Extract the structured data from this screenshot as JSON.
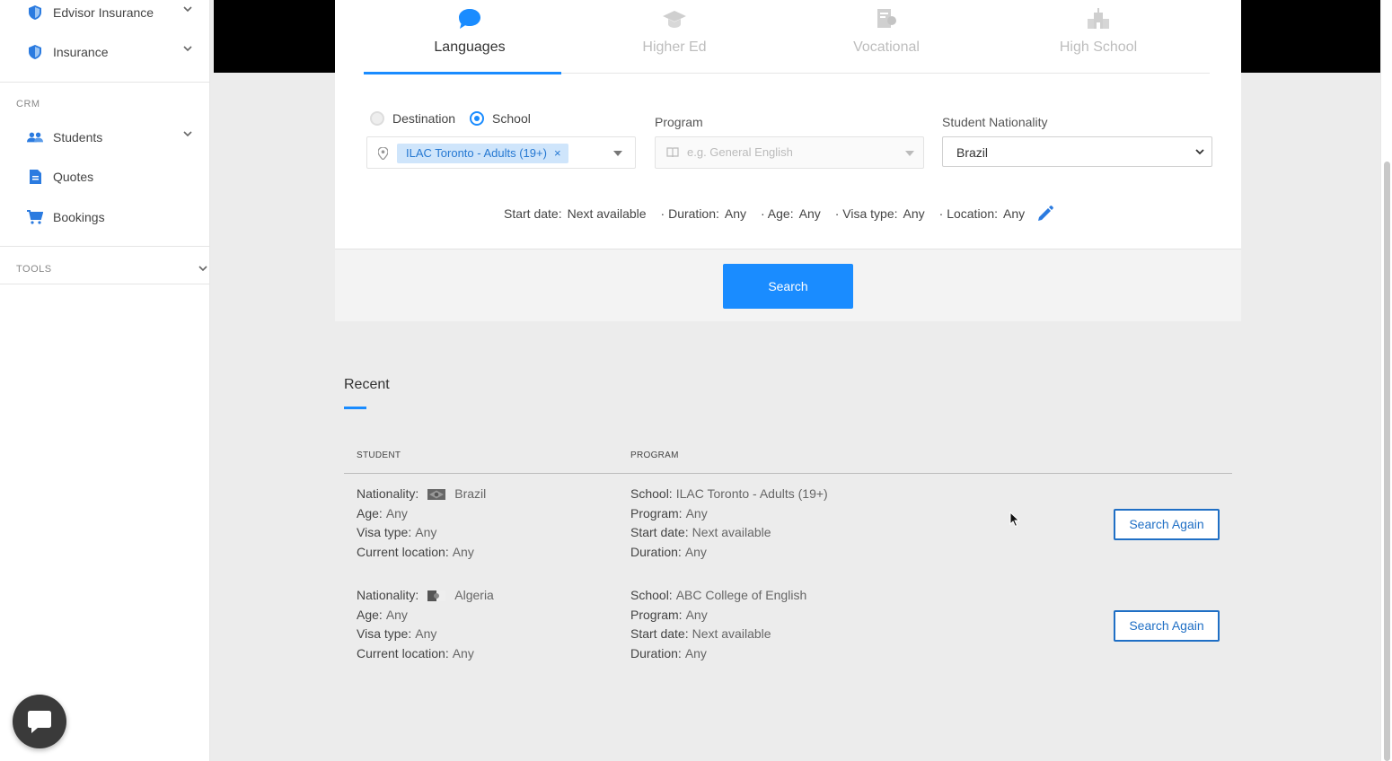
{
  "sidebar": {
    "advisor_insurance": "Edvisor Insurance",
    "insurance": "Insurance",
    "crm_label": "CRM",
    "students": "Students",
    "quotes": "Quotes",
    "bookings": "Bookings",
    "tools_label": "TOOLS"
  },
  "tabs": [
    {
      "label": "Languages",
      "active": true
    },
    {
      "label": "Higher Ed",
      "active": false
    },
    {
      "label": "Vocational",
      "active": false
    },
    {
      "label": "High School",
      "active": false
    }
  ],
  "search_form": {
    "radio_destination": "Destination",
    "radio_school": "School",
    "selected_mode": "School",
    "school_chip": "ILAC Toronto - Adults (19+)",
    "chip_remove": "×",
    "program_label": "Program",
    "program_placeholder": "e.g. General English",
    "nationality_label": "Student Nationality",
    "nationality_value": "Brazil"
  },
  "filters": {
    "start_date_label": "Start date:",
    "start_date_value": "Next available",
    "duration_label": "· Duration:",
    "duration_value": "Any",
    "age_label": "· Age:",
    "age_value": "Any",
    "visa_label": "· Visa type:",
    "visa_value": "Any",
    "location_label": "· Location:",
    "location_value": "Any"
  },
  "search_button": "Search",
  "recent": {
    "title": "Recent",
    "col_student": "STUDENT",
    "col_program": "PROGRAM",
    "search_again": "Search Again",
    "rows": [
      {
        "nationality_label": "Nationality:",
        "nationality": "Brazil",
        "age_label": "Age:",
        "age": "Any",
        "visa_label": "Visa type:",
        "visa": "Any",
        "location_label": "Current location:",
        "location": "Any",
        "school_label": "School:",
        "school": "ILAC Toronto - Adults (19+)",
        "program_label": "Program:",
        "program": "Any",
        "start_label": "Start date:",
        "start": "Next available",
        "duration_label": "Duration:",
        "duration": "Any"
      },
      {
        "nationality_label": "Nationality:",
        "nationality": "Algeria",
        "age_label": "Age:",
        "age": "Any",
        "visa_label": "Visa type:",
        "visa": "Any",
        "location_label": "Current location:",
        "location": "Any",
        "school_label": "School:",
        "school": "ABC College of English",
        "program_label": "Program:",
        "program": "Any",
        "start_label": "Start date:",
        "start": "Next available",
        "duration_label": "Duration:",
        "duration": "Any"
      }
    ]
  },
  "colors": {
    "accent": "#1a8cff",
    "chip_bg": "#cfe5fb",
    "button_outline": "#1f6fc5"
  }
}
